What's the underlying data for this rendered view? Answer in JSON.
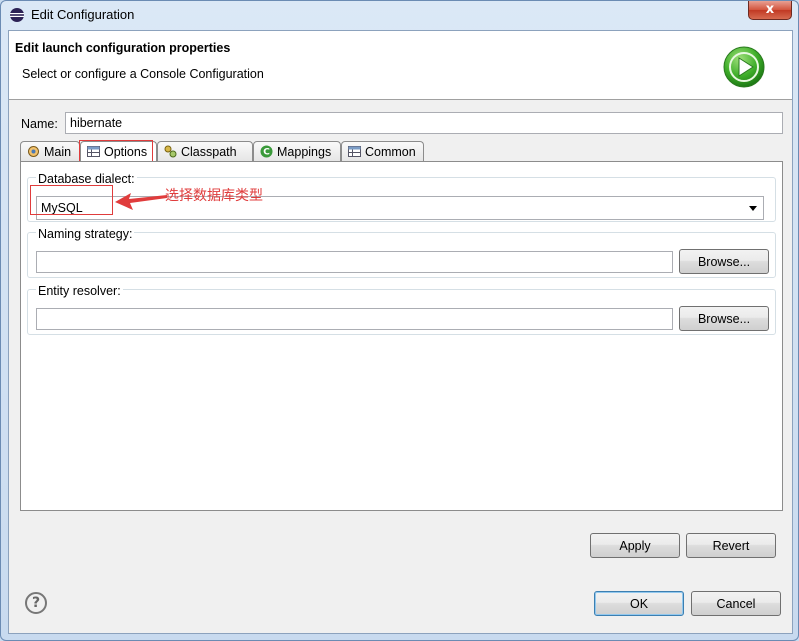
{
  "window": {
    "title": "Edit Configuration",
    "close_glyph": "x"
  },
  "header": {
    "title": "Edit launch configuration properties",
    "subtitle": "Select or configure a Console Configuration",
    "icon": "run-icon"
  },
  "name": {
    "label": "Name:",
    "value": "hibernate"
  },
  "tabs": [
    {
      "label": "Main",
      "icon": "main-tab-icon",
      "active": false
    },
    {
      "label": "Options",
      "icon": "table-icon",
      "active": true
    },
    {
      "label": "Classpath",
      "icon": "classpath-icon",
      "active": false
    },
    {
      "label": "Mappings",
      "icon": "mappings-icon",
      "active": false
    },
    {
      "label": "Common",
      "icon": "table-icon",
      "active": false
    }
  ],
  "options": {
    "dialect_label": "Database dialect:",
    "dialect_value": "MySQL",
    "naming_label": "Naming strategy:",
    "naming_value": "",
    "resolver_label": "Entity resolver:",
    "resolver_value": "",
    "browse_label": "Browse..."
  },
  "annotation": {
    "text": "选择数据库类型",
    "color": "#e03c3c"
  },
  "buttons": {
    "apply": "Apply",
    "revert": "Revert",
    "ok": "OK",
    "cancel": "Cancel",
    "help_glyph": "?"
  }
}
